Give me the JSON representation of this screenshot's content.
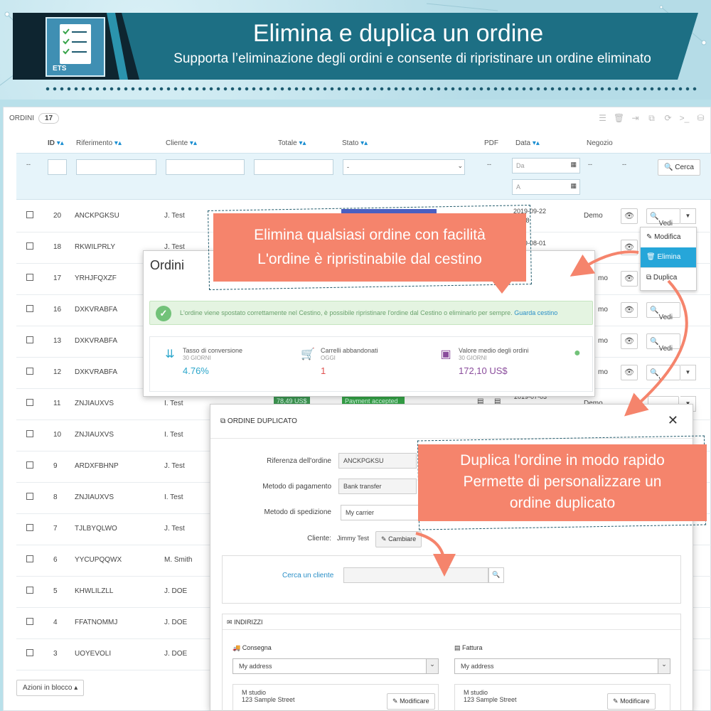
{
  "banner": {
    "title": "Elimina e duplica un ordine",
    "subtitle": "Supporta l’eliminazione degli ordini e consente di ripristinare un ordine eliminato",
    "logo_text": "ETS"
  },
  "orders": {
    "title": "ORDINI",
    "count": "17",
    "columns": {
      "id": "ID",
      "ref": "Riferimento",
      "client": "Cliente",
      "total": "Totale",
      "status": "Stato",
      "pdf": "PDF",
      "date": "Data",
      "shop": "Negozio"
    },
    "filter": {
      "dash1": "--",
      "status_default": "-",
      "pdf_dash": "--",
      "date_from": "Da",
      "date_to": "A",
      "dash2": "--",
      "dash3": "--",
      "search_label": "Cerca"
    },
    "rows": [
      {
        "id": "20",
        "ref": "ANCKPGKSU",
        "client": "J. Test",
        "date": "2019-09-22",
        "time": "20:28",
        "shop": "Demo"
      },
      {
        "id": "18",
        "ref": "RKWILPRLY",
        "client": "J. Test",
        "date": "2019-08-01"
      },
      {
        "id": "17",
        "ref": "YRHJFQXZF"
      },
      {
        "id": "16",
        "ref": "DXKVRABFA"
      },
      {
        "id": "13",
        "ref": "DXKVRABFA"
      },
      {
        "id": "12",
        "ref": "DXKVRABFA"
      },
      {
        "id": "11",
        "ref": "ZNJIAUXVS",
        "client": "I. Test",
        "total": "78,49 US$",
        "status": "Payment accepted",
        "date": "2019-07-03",
        "shop": "Demo"
      },
      {
        "id": "10",
        "ref": "ZNJIAUXVS",
        "client": "I. Test"
      },
      {
        "id": "9",
        "ref": "ARDXFBHNP",
        "client": "J. Test"
      },
      {
        "id": "8",
        "ref": "ZNJIAUXVS",
        "client": "I. Test"
      },
      {
        "id": "7",
        "ref": "TJLBYQLWO",
        "client": "J. Test"
      },
      {
        "id": "6",
        "ref": "YYCUPQQWX",
        "client": "M. Smith"
      },
      {
        "id": "5",
        "ref": "KHWLILZLL",
        "client": "J. DOE"
      },
      {
        "id": "4",
        "ref": "FFATNOMMJ",
        "client": "J. DOE"
      },
      {
        "id": "3",
        "ref": "UOYEVOLI",
        "client": "J. DOE"
      }
    ],
    "partial_shop": [
      "mo",
      "mo",
      "mo",
      "mo"
    ],
    "view_label": "Vedi",
    "view_partial": "V",
    "view_partial2": "di",
    "bulk_label": "Azioni in blocco ▴"
  },
  "dropdown": {
    "edit": "Modifica",
    "delete": "Elimina",
    "duplicate": "Duplica"
  },
  "modal_success": {
    "title": "Ordini",
    "message": "L'ordine viene spostato correttamente nel Cestino, è possibile ripristinare l'ordine dal Cestino o eliminarlo per sempre.",
    "link": "Guarda cestino",
    "kpis": [
      {
        "label": "Tasso di conversione",
        "sub": "30 GIORNI",
        "value": "4.76%",
        "color": "#2ba6cb"
      },
      {
        "label": "Carrelli abbandonati",
        "sub": "OGGI",
        "value": "1",
        "color": "#e0504e"
      },
      {
        "label": "Valore medio degli ordini",
        "sub": "30 GIORNI",
        "value": "172,10 US$",
        "color": "#8a4c9c"
      }
    ]
  },
  "modal_duplicate": {
    "title": "ORDINE DUPLICATO",
    "ref_label": "Riferenza dell'ordine",
    "ref_value": "ANCKPGKSU",
    "payment_label": "Metodo di pagamento",
    "payment_value": "Bank transfer",
    "shipping_label": "Metodo di spedizione",
    "shipping_value": "My carrier",
    "client_label": "Cliente:",
    "client_value": "Jimmy Test",
    "change_label": "Cambiare",
    "search_label": "Cerca un cliente",
    "addresses_label": "INDIRIZZI",
    "delivery_label": "Consegna",
    "invoice_label": "Fattura",
    "delivery_select": "My address",
    "invoice_select": "My address",
    "addr_name": "M studio",
    "addr_street": "123 Sample Street",
    "edit_label": "Modificare"
  },
  "callouts": {
    "delete_line1": "Elimina qualsiasi ordine con facilità",
    "delete_line2": "L'ordine è ripristinabile dal cestino",
    "dup_line1": "Duplica l'ordine in modo rapido",
    "dup_line2": "Permette di personalizzare un",
    "dup_line3": "ordine duplicato"
  }
}
